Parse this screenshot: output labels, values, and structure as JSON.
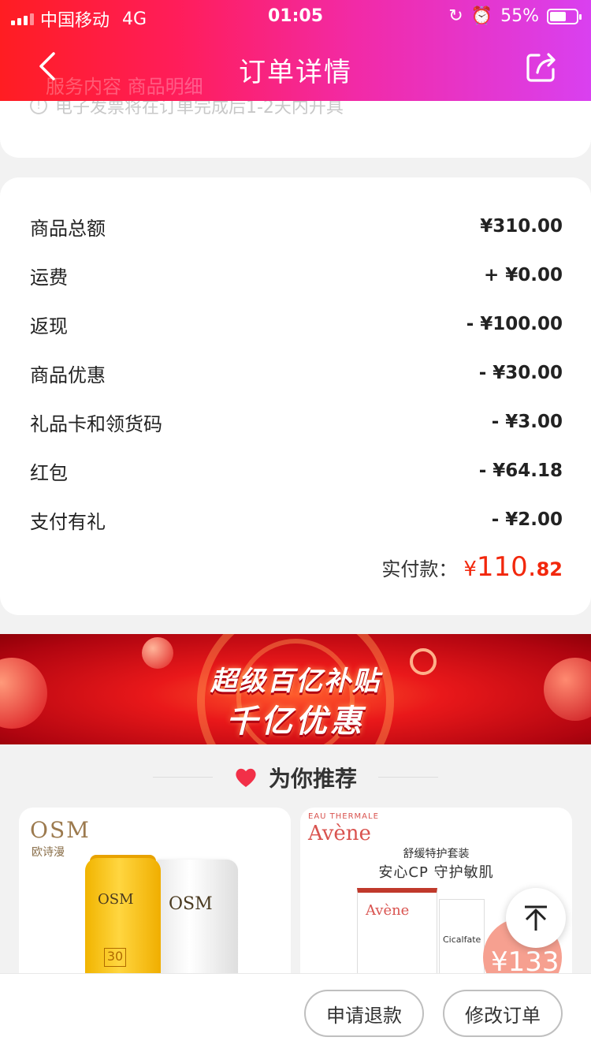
{
  "status_bar": {
    "carrier": "中国移动",
    "network": "4G",
    "time": "01:05",
    "battery": "55%"
  },
  "nav": {
    "title": "订单详情",
    "ghost_tabs": "服务内容    商品明细"
  },
  "invoice_note": "电子发票将在订单完成后1-2天内开具",
  "price_rows": [
    {
      "label": "商品总额",
      "value": "¥310.00"
    },
    {
      "label": "运费",
      "value": "+ ¥0.00"
    },
    {
      "label": "返现",
      "value": "- ¥100.00"
    },
    {
      "label": "商品优惠",
      "value": "- ¥30.00"
    },
    {
      "label": "礼品卡和领货码",
      "value": "- ¥3.00"
    },
    {
      "label": "红包",
      "value": "- ¥64.18"
    },
    {
      "label": "支付有礼",
      "value": "- ¥2.00"
    }
  ],
  "total": {
    "label": "实付款：",
    "currency": "¥",
    "integer": "110.",
    "decimal": "82"
  },
  "banner": {
    "line1": "超级百亿补贴",
    "line2": "千亿优惠"
  },
  "recommend": {
    "title": "为你推荐"
  },
  "products": [
    {
      "brand": "OSM",
      "brand_cn": "欧诗漫",
      "tube1": "OSM",
      "tube2": "OSM",
      "spf": "30"
    },
    {
      "brand_small": "EAU THERMALE",
      "brand": "Avène",
      "line1": "舒缓特护套装",
      "line2": "安心CP  守护敏肌",
      "box1": "Avène",
      "box2": "Cicalfate",
      "price": "¥133"
    }
  ],
  "actions": {
    "refund": "申请退款",
    "modify": "修改订单"
  },
  "colors": {
    "accent_red": "#f2270c",
    "header_start": "#ff1d22",
    "header_end": "#d940f0"
  }
}
